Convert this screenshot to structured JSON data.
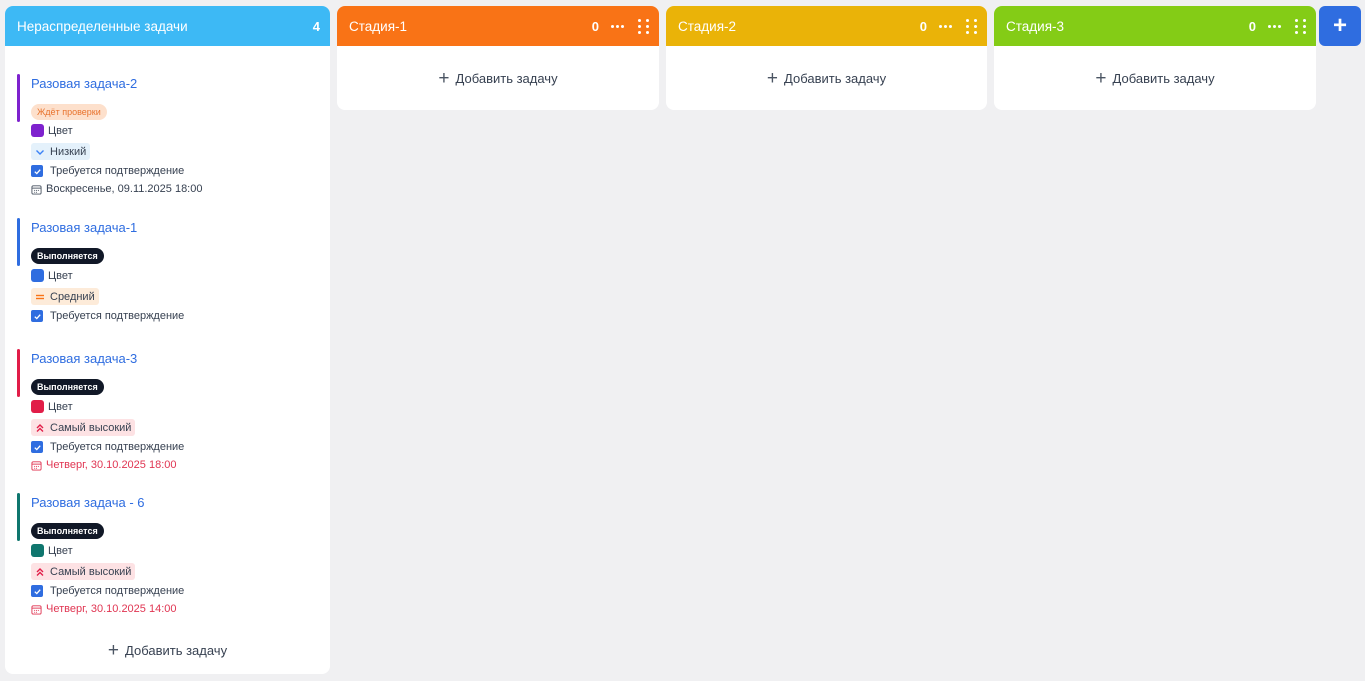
{
  "columns": [
    {
      "title": "Нераспределенные задачи",
      "count": "4",
      "color": "#3db9f5"
    },
    {
      "title": "Стадия-1",
      "count": "0",
      "color": "#f97316"
    },
    {
      "title": "Стадия-2",
      "count": "0",
      "color": "#eab308"
    },
    {
      "title": "Стадия-3",
      "count": "0",
      "color": "#84cc16"
    }
  ],
  "add_task_label": "Добавить задачу",
  "add_column_label": "+",
  "tasks": [
    {
      "title": "Разовая задача-2",
      "status": "Ждёт проверки",
      "color_label": "Цвет",
      "color": "#7e22ce",
      "priority": "Низкий",
      "priority_icon": "chevron-down-icon",
      "confirm": "Требуется подтверждение",
      "date": "Воскресенье, 09.11.2025 18:00",
      "date_overdue": false
    },
    {
      "title": "Разовая задача-1",
      "status": "Выполняется",
      "color_label": "Цвет",
      "color": "#2f6de0",
      "priority": "Средний",
      "priority_icon": "equals-icon",
      "confirm": "Требуется подтверждение",
      "date": "",
      "date_overdue": false
    },
    {
      "title": "Разовая задача-3",
      "status": "Выполняется",
      "color_label": "Цвет",
      "color": "#e11d48",
      "priority": "Самый высокий",
      "priority_icon": "double-chevron-up-icon",
      "confirm": "Требуется подтверждение",
      "date": "Четверг, 30.10.2025 18:00",
      "date_overdue": true
    },
    {
      "title": "Разовая задача - 6",
      "status": "Выполняется",
      "color_label": "Цвет",
      "color": "#0f766e",
      "priority": "Самый высокий",
      "priority_icon": "double-chevron-up-icon",
      "confirm": "Требуется подтверждение",
      "date": "Четверг, 30.10.2025 14:00",
      "date_overdue": true
    }
  ]
}
